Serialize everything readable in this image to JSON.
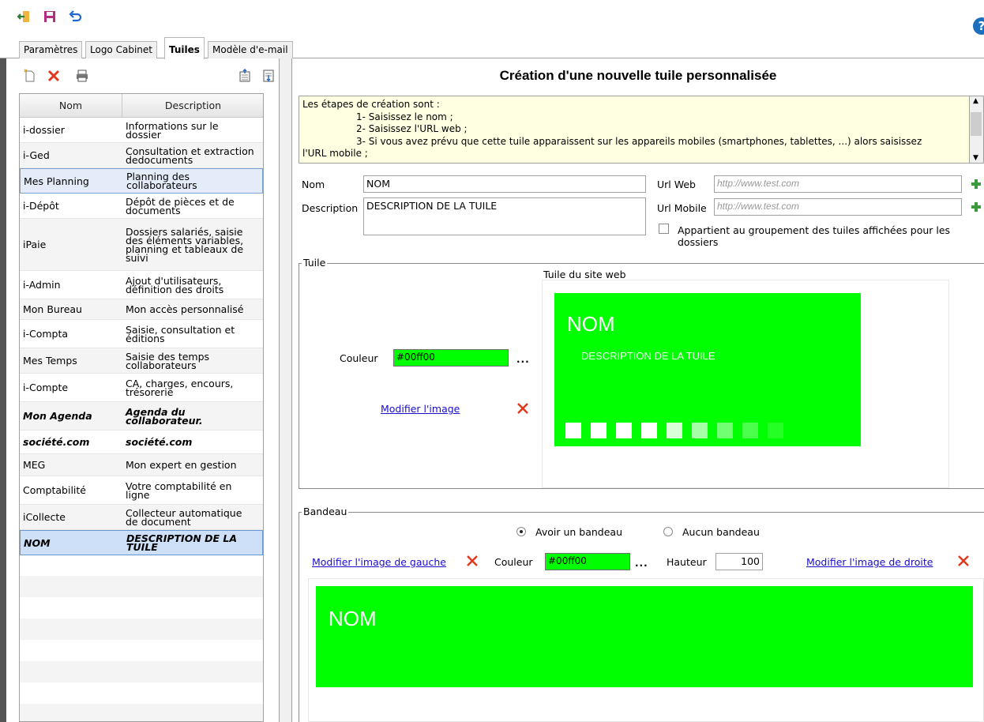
{
  "toolbar": {
    "icons": [
      "exit-icon",
      "save-icon",
      "undo-icon",
      "help-icon"
    ],
    "help_label": "?"
  },
  "tabs": [
    {
      "label": "Paramètres"
    },
    {
      "label": "Logo Cabinet"
    },
    {
      "label": "Tuiles"
    },
    {
      "label": "Modèle d'e-mail"
    }
  ],
  "grid": {
    "headers": {
      "name": "Nom",
      "description": "Description"
    },
    "rows": [
      {
        "name": "i-dossier",
        "description": "Informations sur le dossier"
      },
      {
        "name": "i-Ged",
        "description": "Consultation et extraction dedocuments"
      },
      {
        "name": "Mes Planning",
        "description": "Planning des collaborateurs"
      },
      {
        "name": "i-Dépôt",
        "description": "Dépôt de pièces et de documents"
      },
      {
        "name": "iPaie",
        "description": "Dossiers salariés, saisie des éléments variables, planning et tableaux de suivi"
      },
      {
        "name": "i-Admin",
        "description": "Ajout d'utilisateurs, définition des droits"
      },
      {
        "name": "Mon Bureau",
        "description": "Mon accès personnalisé"
      },
      {
        "name": "i-Compta",
        "description": "Saisie, consultation et éditions"
      },
      {
        "name": "Mes Temps",
        "description": "Saisie des temps collaborateurs"
      },
      {
        "name": "i-Compte",
        "description": "CA, charges, encours, trésorerie"
      },
      {
        "name": "Mon Agenda",
        "description": "Agenda du collaborateur."
      },
      {
        "name": "société.com",
        "description": "société.com"
      },
      {
        "name": "MEG",
        "description": "Mon expert en gestion"
      },
      {
        "name": "Comptabilité",
        "description": "Votre comptabilité en ligne"
      },
      {
        "name": "iCollecte",
        "description": "Collecteur automatique de document"
      },
      {
        "name": "NOM",
        "description": "DESCRIPTION DE LA TUILE"
      }
    ]
  },
  "form": {
    "title": "Création d'une nouvelle tuile personnalisée",
    "info_lines": [
      "Les étapes de création sont :",
      "1- Saisissez le nom ;",
      "2- Saisissez l'URL web ;",
      "3- Si vous avez prévu que cette tuile apparaissent sur les appareils mobiles (smartphones, tablettes, ...) alors saisissez",
      "l'URL mobile ;"
    ],
    "nom_label": "Nom",
    "nom_value": "NOM",
    "description_label": "Description",
    "description_value": "DESCRIPTION DE LA TUILE",
    "url_web_label": "Url Web",
    "url_web_placeholder": "http://www.test.com",
    "url_mobile_label": "Url Mobile",
    "url_mobile_placeholder": "http://www.test.com",
    "groupement_label": "Appartient au groupement des tuiles affichées pour les dossiers",
    "groupement_checked": false
  },
  "tuile": {
    "legend": "Tuile",
    "preview_label": "Tuile du site web",
    "couleur_label": "Couleur",
    "couleur_value": "#00ff00",
    "dots": "...",
    "modify_image": "Modifier l'image",
    "tile_title": "NOM",
    "tile_description": "DESCRIPTION DE LA TUILE",
    "tile_color": "#00ff00"
  },
  "bandeau": {
    "legend": "Bandeau",
    "radio_with": "Avoir un bandeau",
    "radio_without": "Aucun bandeau",
    "selected": "with",
    "modify_left": "Modifier l'image de gauche",
    "couleur_label": "Couleur",
    "couleur_value": "#00ff00",
    "dots": "...",
    "hauteur_label": "Hauteur",
    "hauteur_value": "100",
    "modify_right": "Modifier l'image de droite",
    "banner_title": "NOM"
  }
}
